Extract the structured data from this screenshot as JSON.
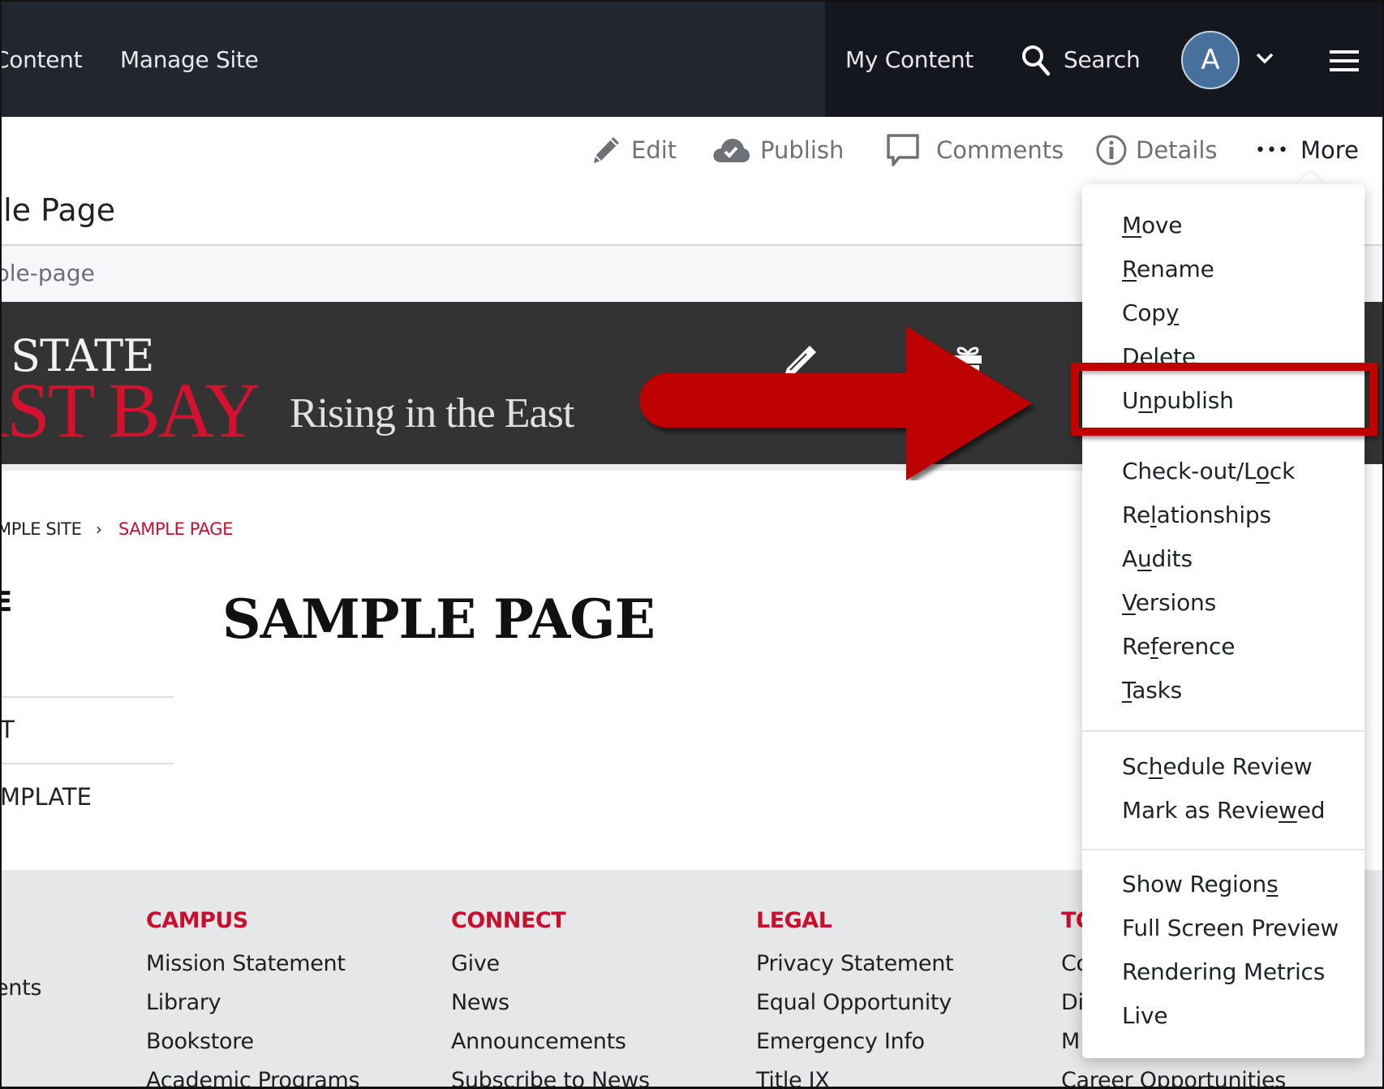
{
  "topnav": {
    "content_label": "Content",
    "manage_site_label": "Manage Site",
    "my_content_label": "My Content",
    "search_label": "Search",
    "avatar_initial": "A"
  },
  "toolbar": {
    "edit_label": "Edit",
    "publish_label": "Publish",
    "comments_label": "Comments",
    "details_label": "Details",
    "more_label": "More",
    "more_dots": "•••"
  },
  "page": {
    "title": "ple Page",
    "path": "ple-page"
  },
  "banner": {
    "logo_line1": "L STATE",
    "logo_line2": "AST BAY",
    "tagline": "Rising in the East"
  },
  "breadcrumb": {
    "site": "MPLE SITE",
    "separator": "›",
    "current": "SAMPLE PAGE"
  },
  "content": {
    "side_heading": "E",
    "heading": "SAMPLE PAGE",
    "side_items": [
      "T",
      "MPLATE"
    ]
  },
  "footer": {
    "left_partial": "ents",
    "columns": [
      {
        "heading": "CAMPUS",
        "links": [
          "Mission Statement",
          "Library",
          "Bookstore",
          "Academic Programs"
        ]
      },
      {
        "heading": "CONNECT",
        "links": [
          "Give",
          "News",
          "Announcements",
          "Subscribe to News"
        ]
      },
      {
        "heading": "LEGAL",
        "links": [
          "Privacy Statement",
          "Equal Opportunity",
          "Emergency Info",
          "Title IX"
        ]
      },
      {
        "heading": "TO",
        "links": [
          "Co",
          "Di",
          "M",
          "Career Opportunities"
        ]
      }
    ]
  },
  "more_menu": {
    "groups": [
      [
        {
          "label": "Move",
          "pre": "",
          "key": "M",
          "post": "ove"
        },
        {
          "label": "Rename",
          "pre": "",
          "key": "R",
          "post": "ename"
        },
        {
          "label": "Copy",
          "pre": "Cop",
          "key": "y",
          "post": ""
        },
        {
          "label": "Delete",
          "pre": "Delet",
          "key": "e",
          "post": ""
        },
        {
          "label": "Unpublish",
          "pre": "U",
          "key": "n",
          "post": "publish",
          "highlighted": true
        }
      ],
      [
        {
          "label": "Check-out/Lock",
          "pre": "Check-out/L",
          "key": "o",
          "post": "ck"
        },
        {
          "label": "Relationships",
          "pre": "Re",
          "key": "l",
          "post": "ationships"
        },
        {
          "label": "Audits",
          "pre": "A",
          "key": "u",
          "post": "dits"
        },
        {
          "label": "Versions",
          "pre": "",
          "key": "V",
          "post": "ersions"
        },
        {
          "label": "Reference",
          "pre": "Re",
          "key": "f",
          "post": "erence"
        },
        {
          "label": "Tasks",
          "pre": "",
          "key": "T",
          "post": "asks"
        }
      ],
      [
        {
          "label": "Schedule Review",
          "pre": "Sc",
          "key": "h",
          "post": "edule Review"
        },
        {
          "label": "Mark as Reviewed",
          "pre": "Mark as Revie",
          "key": "w",
          "post": "ed"
        }
      ],
      [
        {
          "label": "Show Regions",
          "pre": "Show Region",
          "key": "s",
          "post": ""
        },
        {
          "label": "Full Screen Preview",
          "pre": "Full Screen Preview",
          "key": "",
          "post": ""
        },
        {
          "label": "Rendering Metrics",
          "pre": "Rendering Metrics",
          "key": "",
          "post": ""
        },
        {
          "label": "Live",
          "pre": "Live",
          "key": "",
          "post": ""
        }
      ]
    ]
  },
  "annotation": {
    "arrow_color": "#c00000",
    "highlight_target": "Unpublish"
  },
  "colors": {
    "nav_bg": "#22262f",
    "nav_bg_right": "#14171e",
    "avatar": "#47719c",
    "brand_red": "#c8102e",
    "banner_bg": "#333333",
    "footer_bg": "#e6e7e9"
  }
}
